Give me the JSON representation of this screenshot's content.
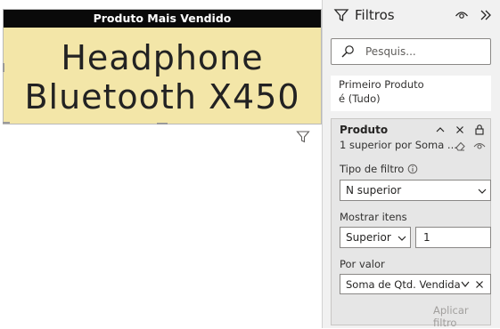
{
  "card": {
    "title": "Produto Mais Vendido",
    "value_line1": "Headphone",
    "value_line2": "Bluetooth X450"
  },
  "filters_pane": {
    "title": "Filtros",
    "search_placeholder": "Pesquis...",
    "page_filter": {
      "name": "Primeiro Produto",
      "value": "é (Tudo)"
    },
    "product_filter": {
      "name": "Produto",
      "summary": "1 superior por Soma ...",
      "filter_type_label": "Tipo de filtro",
      "filter_type_value": "N superior",
      "show_items_label": "Mostrar itens",
      "show_items_direction": "Superior",
      "show_items_count": "1",
      "by_value_label": "Por valor",
      "by_value_field": "Soma de Qtd. Vendida",
      "apply_button": "Aplicar filtro"
    }
  },
  "colors": {
    "card_background": "#f3e6a8",
    "card_header": "#0a0a0a",
    "pane_background": "#f1f1f1"
  },
  "icons": [
    "funnel-icon",
    "eye-icon",
    "collapse-chevrons-icon",
    "search-icon",
    "chevron-up-icon",
    "close-icon",
    "lock-icon",
    "eraser-icon",
    "info-icon",
    "chevron-down-icon"
  ]
}
